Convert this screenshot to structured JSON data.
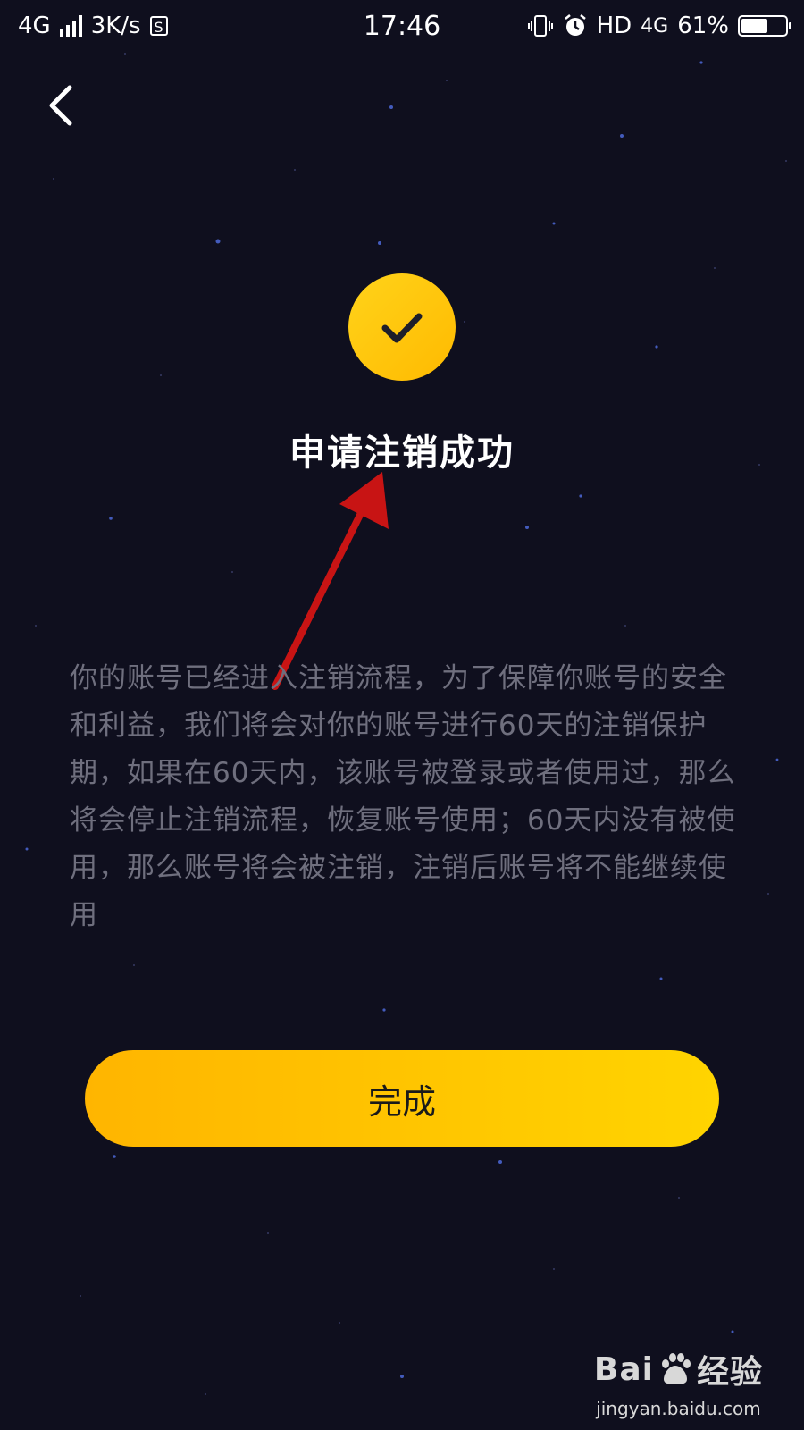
{
  "statusbar": {
    "network_left": "4G",
    "speed": "3K/s",
    "s_badge": "S",
    "time": "17:46",
    "hd": "HD",
    "network_right": "4G",
    "battery": "61%",
    "battery_level": 0.61
  },
  "page": {
    "title": "申请注销成功",
    "description": "你的账号已经进入注销流程，为了保障你账号的安全和利益，我们将会对你的账号进行60天的注销保护期，如果在60天内，该账号被登录或者使用过，那么将会停止注销流程，恢复账号使用；60天内没有被使用，那么账号将会被注销，注销后账号将不能继续使用",
    "done_button": "完成"
  },
  "watermark": {
    "brand_left": "Bai",
    "brand_right": "经验",
    "url": "jingyan.baidu.com"
  },
  "colors": {
    "background": "#0f0f1e",
    "accent": "#ffc400",
    "annotation_arrow": "#c81414"
  }
}
